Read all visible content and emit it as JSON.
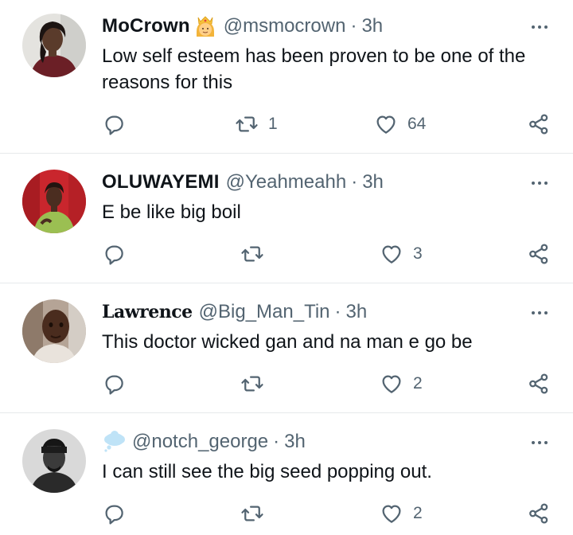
{
  "tweets": [
    {
      "name": "MoCrown",
      "handle": "@msmocrown",
      "time": "3h",
      "text": "Low self esteem has been proven to be one of the reasons for this",
      "replies": "",
      "retweets": "1",
      "likes": "64",
      "name_emoji": "crowned-person-emoji"
    },
    {
      "name": "OLUWAYEMI",
      "handle": "@Yeahmeahh",
      "time": "3h",
      "text": "E be like big boil",
      "replies": "",
      "retweets": "",
      "likes": "3"
    },
    {
      "name": "Lawrence",
      "handle": "@Big_Man_Tin",
      "time": "3h",
      "text": "This doctor wicked gan and na man e go be",
      "replies": "",
      "retweets": "",
      "likes": "2"
    },
    {
      "name": "",
      "handle": "@notch_george",
      "time": "3h",
      "text": "I can still see the big seed popping out.",
      "replies": "",
      "retweets": "",
      "likes": "2",
      "name_emoji": "thought-balloon-emoji"
    }
  ],
  "separator": "·",
  "icons": {
    "reply": "reply-icon",
    "retweet": "retweet-icon",
    "like": "heart-icon",
    "share": "share-icon",
    "more": "more-icon"
  },
  "colors": {
    "text": "#0f1419",
    "secondary": "#536471",
    "divider": "#e6e9eb",
    "background": "#ffffff"
  }
}
